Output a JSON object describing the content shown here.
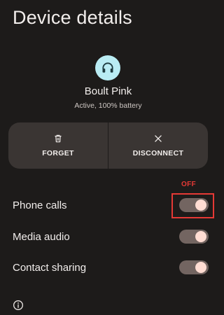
{
  "header": {
    "title": "Device details"
  },
  "device": {
    "icon": "headset-icon",
    "name": "Boult Pink",
    "status": "Active, 100% battery"
  },
  "actions": [
    {
      "label": "FORGET",
      "icon": "trash-icon"
    },
    {
      "label": "DISCONNECT",
      "icon": "close-icon"
    }
  ],
  "settings": [
    {
      "label": "Phone calls",
      "enabled": true
    },
    {
      "label": "Media audio",
      "enabled": true
    },
    {
      "label": "Contact sharing",
      "enabled": true
    }
  ],
  "annotation": {
    "text": "OFF",
    "color": "#e53935"
  },
  "footer": {
    "icon": "info-icon"
  },
  "colors": {
    "background": "#1d1b1a",
    "card": "#3a3533",
    "accent_icon_bg": "#b9ecf3",
    "toggle_track": "#736561",
    "toggle_thumb": "#ffdcd2"
  }
}
